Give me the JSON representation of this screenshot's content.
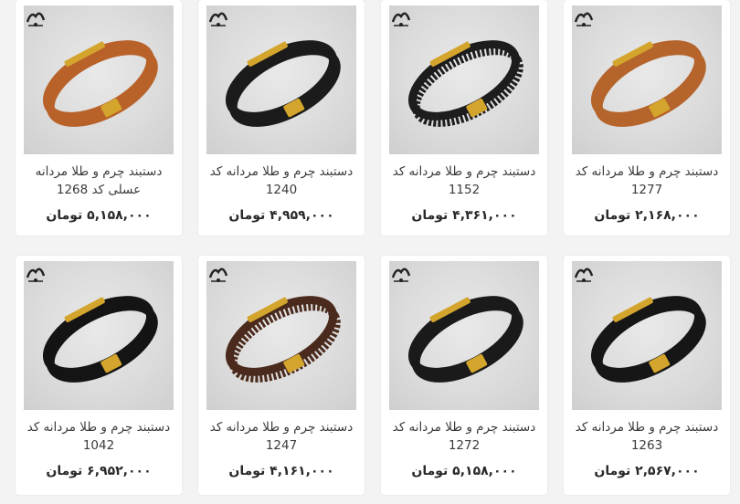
{
  "products": [
    {
      "title": "دستبند چرم و طلا مردانه کد 1277",
      "price": "۲,۱۶۸,۰۰۰ تومان",
      "leather_color": "#b5642b",
      "image_alt": "brown leather bracelet"
    },
    {
      "title": "دستبند چرم و طلا مردانه کد 1152",
      "price": "۴,۳۶۱,۰۰۰ تومان",
      "leather_color": "#1d1d1d",
      "image_alt": "black braided leather bracelet"
    },
    {
      "title": "دستبند چرم و طلا مردانه کد 1240",
      "price": "۴,۹۵۹,۰۰۰ تومان",
      "leather_color": "#1b1b1b",
      "image_alt": "black leather bracelet"
    },
    {
      "title": "دستبند چرم و طلا مردانه عسلی کد 1268",
      "price": "۵,۱۵۸,۰۰۰ تومان",
      "leather_color": "#b8622a",
      "image_alt": "honey leather bracelet"
    },
    {
      "title": "دستبند چرم و طلا مردانه کد 1263",
      "price": "۲,۵۶۷,۰۰۰ تومان",
      "leather_color": "#161616",
      "image_alt": "black leather bracelet with tag"
    },
    {
      "title": "دستبند چرم و طلا مردانه کد 1272",
      "price": "۵,۱۵۸,۰۰۰ تومان",
      "leather_color": "#1a1a1a",
      "image_alt": "black leather bracelet gold plate"
    },
    {
      "title": "دستبند چرم و طلا مردانه کد 1247",
      "price": "۴,۱۶۱,۰۰۰ تومان",
      "leather_color": "#4a2a1c",
      "image_alt": "dark brown braided bracelet"
    },
    {
      "title": "دستبند چرم و طلا مردانه کد 1042",
      "price": "۶,۹۵۲,۰۰۰ تومان",
      "leather_color": "#141414",
      "image_alt": "black leather bracelet cross"
    }
  ],
  "brand_logo": "logo-icon",
  "gold_color": "#d4a52c"
}
